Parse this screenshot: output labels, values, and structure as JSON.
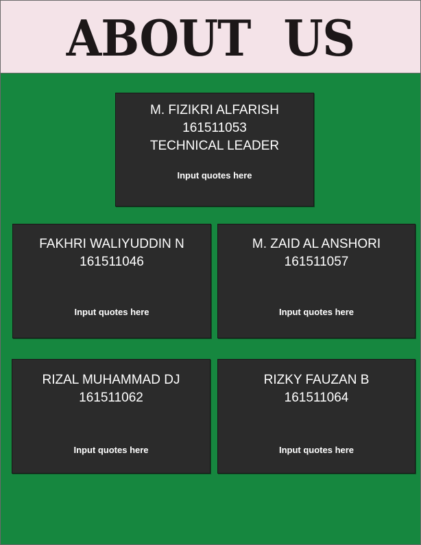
{
  "header": {
    "title": "ABOUT  US"
  },
  "leader": {
    "name": "M. FIZIKRI ALFARISH",
    "id": "161511053",
    "role": "TECHNICAL LEADER",
    "quote": "Input quotes here"
  },
  "members": [
    {
      "name": "FAKHRI WALIYUDDIN N",
      "id": "161511046",
      "quote": "Input quotes here"
    },
    {
      "name": "M. ZAID AL ANSHORI",
      "id": "161511057",
      "quote": "Input quotes here"
    },
    {
      "name": "RIZAL MUHAMMAD DJ",
      "id": "161511062",
      "quote": "Input quotes here"
    },
    {
      "name": "RIZKY FAUZAN B",
      "id": "161511064",
      "quote": "Input quotes here"
    }
  ],
  "colors": {
    "background": "#16873f",
    "header": "#f4e3e8",
    "card": "#2b2b2b",
    "title": "#1c1718"
  }
}
